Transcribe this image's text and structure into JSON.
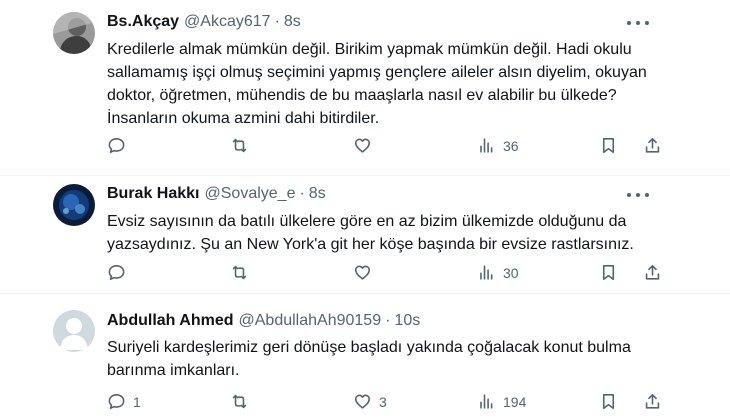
{
  "tweets": [
    {
      "name": "Bs.Akçay",
      "handle": "@Akcay617",
      "separator": "·",
      "time": "8s",
      "text": "Kredilerle almak mümkün değil. Birikim yapmak mümkün değil. Hadi okulu sallamamış işçi olmuş seçimini yapmış gençlere aileler alsın diyelim, okuyan doktor, öğretmen, mühendis de bu maaşlarla nasıl ev alabilir bu ülkede? İnsanların okuma azmini dahi bitirdiler.",
      "reply_count": "",
      "retweet_count": "",
      "like_count": "",
      "views": "36",
      "avatar_icon": "avatar-photo-grayscale"
    },
    {
      "name": "Burak Hakkı",
      "handle": "@Sovalye_e",
      "separator": "·",
      "time": "8s",
      "text": "Evsiz sayısının da batılı ülkelere göre en az bizim ülkemizde olduğunu da yazsaydınız. Şu an New York'a git her köşe başında bir evsize rastlarsınız.",
      "reply_count": "",
      "retweet_count": "",
      "like_count": "",
      "views": "30",
      "avatar_icon": "avatar-photo-blue"
    },
    {
      "name": "Abdullah Ahmed",
      "handle": "@AbdullahAh90159",
      "separator": "·",
      "time": "10s",
      "text": "Suriyeli kardeşlerimiz geri dönüşe başladı yakında çoğalacak  konut bulma barınma imkanları.",
      "reply_count": "1",
      "retweet_count": "",
      "like_count": "3",
      "views": "194",
      "avatar_icon": "default-avatar-icon"
    }
  ],
  "colors": {
    "text": "#0f1419",
    "secondary": "#536471",
    "divider": "#eff3f4",
    "default_avatar": "#cfd9de"
  }
}
